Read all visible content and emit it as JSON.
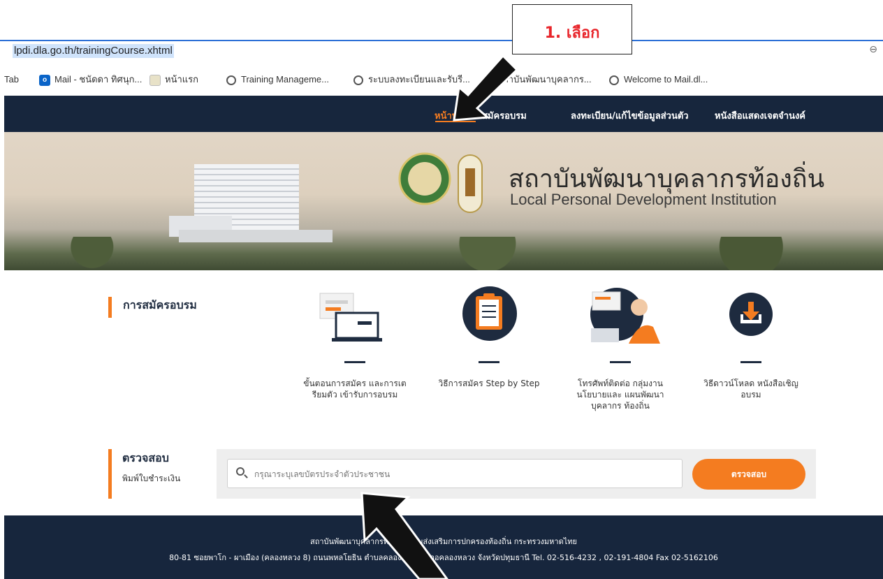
{
  "browser": {
    "url": "lpdi.dla.go.th/trainingCourse.xhtml",
    "bookmarks": [
      {
        "label": "Tab",
        "icon": "none"
      },
      {
        "label": "Mail - ชนัดดา ทิศนุก...",
        "icon": "outlook-icon"
      },
      {
        "label": "หน้าแรก",
        "icon": "page-icon"
      },
      {
        "label": "Training Manageme...",
        "icon": "globe-icon"
      },
      {
        "label": "ระบบลงทะเบียนและรับรี...",
        "icon": "globe-icon"
      },
      {
        "label": "สถาบันพัฒนาบุคลากร...",
        "icon": "none"
      },
      {
        "label": "Welcome to Mail.dl...",
        "icon": "globe-icon"
      }
    ]
  },
  "nav": {
    "items": [
      "หน้าหลัก",
      "สมัครอบรม",
      "ลงทะเบียน/แก้ไขข้อมูลส่วนตัว",
      "หนังสือแสดงเจตจำนงค์"
    ],
    "active_index": 0,
    "accent": "#f47c20",
    "background": "#17263d"
  },
  "hero": {
    "title": "สถาบันพัฒนาบุคลากรท้องถิ่น",
    "subtitle": "Local Personal Development Institution"
  },
  "register": {
    "title": "การสมัครอบรม",
    "steps": [
      {
        "icon": "document-laptop-icon",
        "label": "ขั้นตอนการสมัคร และการเตรียมตัว เข้ารับการอบรม"
      },
      {
        "icon": "clipboard-icon",
        "label": "วิธีการสมัคร Step by Step"
      },
      {
        "icon": "call-center-icon",
        "label": "โทรศัพท์ติดต่อ กลุ่มงานนโยบายและ แผนพัฒนาบุคลากร ท้องถิ่น"
      },
      {
        "icon": "download-icon",
        "label": "วิธีดาวน์โหลด หนังสือเชิญอบรม"
      }
    ]
  },
  "check": {
    "title": "ตรวจสอบ",
    "subtitle": "พิมพ์ใบชำระเงิน",
    "placeholder": "กรุณาระบุเลขบัตรประจำตัวประชาชน",
    "button": "ตรวจสอบ"
  },
  "footer": {
    "line1": "สถาบันพัฒนาบุคลากรท้องถิ่น กรมส่งเสริมการปกครองท้องถิ่น กระทรวงมหาดไทย",
    "line2": "80-81 ซอยพาโก - ผาเมือง (คลองหลวง 8) ถนนพหลโยธิน ตำบลคลองหนึ่ง อำเภอคลองหลวง จังหวัดปทุมธานี Tel. 02-516-4232 , 02-191-4804 Fax 02-5162106"
  },
  "annotation": {
    "callout": "1. เลือก"
  }
}
